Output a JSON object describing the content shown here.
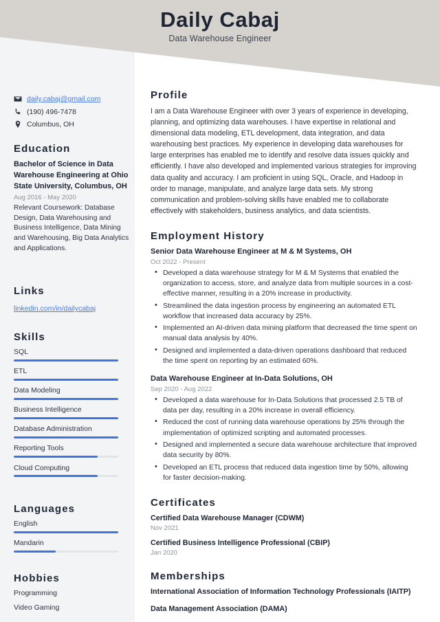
{
  "header": {
    "name": "Daily Cabaj",
    "subtitle": "Data Warehouse Engineer",
    "banner_color": "#d6d3cf"
  },
  "sidebar": {
    "background_color": "#f3f4f6",
    "accent_color": "#3b74e4",
    "link_color": "#4a7ae0",
    "contact": {
      "email": "daily.cabaj@gmail.com",
      "email_icon": "envelope-icon",
      "phone": "(190) 496-7478",
      "phone_icon": "phone-icon",
      "location": "Columbus, OH",
      "location_icon": "location-pin-icon"
    },
    "education": {
      "heading": "Education",
      "entries": [
        {
          "title": "Bachelor of Science in Data Warehouse Engineering at Ohio State University, Columbus, OH",
          "date": "Aug 2016 - May 2020",
          "description": "Relevant Coursework: Database Design, Data Warehousing and Business Intelligence, Data Mining and Warehousing, Big Data Analytics and Applications."
        }
      ]
    },
    "links": {
      "heading": "Links",
      "items": [
        {
          "label": "linkedin.com/in/dailycabaj"
        }
      ]
    },
    "skills": {
      "heading": "Skills",
      "items": [
        {
          "label": "SQL",
          "level": 100
        },
        {
          "label": "ETL",
          "level": 100
        },
        {
          "label": "Data Modeling",
          "level": 100
        },
        {
          "label": "Business Intelligence",
          "level": 100
        },
        {
          "label": "Database Administration",
          "level": 100
        },
        {
          "label": "Reporting Tools",
          "level": 80
        },
        {
          "label": "Cloud Computing",
          "level": 80
        }
      ]
    },
    "languages": {
      "heading": "Languages",
      "items": [
        {
          "label": "English",
          "level": 100
        },
        {
          "label": "Mandarin",
          "level": 40
        }
      ]
    },
    "hobbies": {
      "heading": "Hobbies",
      "items": [
        {
          "label": "Programming"
        },
        {
          "label": "Video Gaming"
        }
      ]
    }
  },
  "main": {
    "profile": {
      "heading": "Profile",
      "text": "I am a Data Warehouse Engineer with over 3 years of experience in developing, planning, and optimizing data warehouses. I have expertise in relational and dimensional data modeling, ETL development, data integration, and data warehousing best practices. My experience in developing data warehouses for large enterprises has enabled me to identify and resolve data issues quickly and efficiently. I have also developed and implemented various strategies for improving data quality and accuracy. I am proficient in using SQL, Oracle, and Hadoop in order to manage, manipulate, and analyze large data sets. My strong communication and problem-solving skills have enabled me to collaborate effectively with stakeholders, business analytics, and data scientists."
    },
    "employment": {
      "heading": "Employment History",
      "jobs": [
        {
          "title": "Senior Data Warehouse Engineer at M & M Systems, OH",
          "date": "Oct 2022 - Present",
          "bullets": [
            "Developed a data warehouse strategy for M & M Systems that enabled the organization to access, store, and analyze data from multiple sources in a cost-effective manner, resulting in a 20% increase in productivity.",
            "Streamlined the data ingestion process by engineering an automated ETL workflow that increased data accuracy by 25%.",
            "Implemented an AI-driven data mining platform that decreased the time spent on manual data analysis by 40%.",
            "Designed and implemented a data-driven operations dashboard that reduced the time spent on reporting by an estimated 60%."
          ]
        },
        {
          "title": "Data Warehouse Engineer at In-Data Solutions, OH",
          "date": "Sep 2020 - Aug 2022",
          "bullets": [
            "Developed a data warehouse for In-Data Solutions that processed 2.5 TB of data per day, resulting in a 20% increase in overall efficiency.",
            "Reduced the cost of running data warehouse operations by 25% through the implementation of optimized scripting and automated processes.",
            "Designed and implemented a secure data warehouse architecture that improved data security by 80%.",
            "Developed an ETL process that reduced data ingestion time by 50%, allowing for faster decision-making."
          ]
        }
      ]
    },
    "certificates": {
      "heading": "Certificates",
      "items": [
        {
          "title": "Certified Data Warehouse Manager (CDWM)",
          "date": "Nov 2021"
        },
        {
          "title": "Certified Business Intelligence Professional (CBIP)",
          "date": "Jan 2020"
        }
      ]
    },
    "memberships": {
      "heading": "Memberships",
      "items": [
        {
          "title": "International Association of Information Technology Professionals (IAITP)"
        },
        {
          "title": "Data Management Association (DAMA)"
        }
      ]
    }
  }
}
